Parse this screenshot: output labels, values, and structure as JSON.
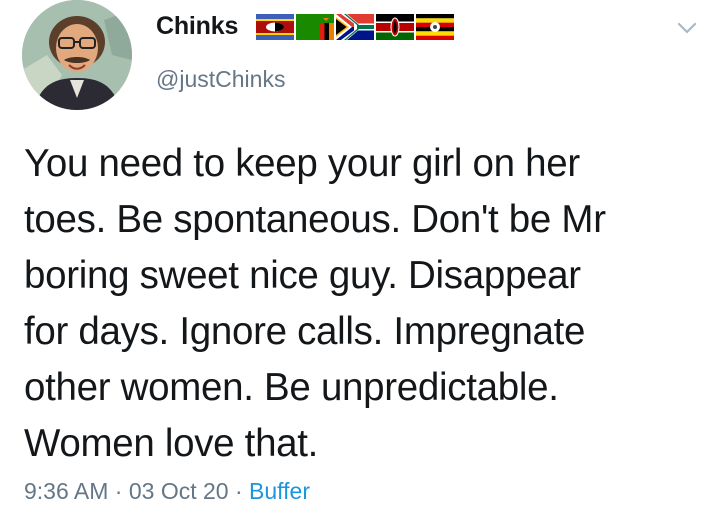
{
  "author": {
    "display_name": "Chinks",
    "handle": "@justChinks",
    "avatar_icon": "avatar-caricature",
    "flags": [
      "eswatini-flag",
      "zambia-flag",
      "south-africa-flag",
      "kenya-flag",
      "uganda-flag"
    ]
  },
  "tweet": {
    "text": "You need to keep your girl on her\ntoes. Be spontaneous. Don't be Mr\nboring sweet nice guy. Disappear\nfor days. Ignore calls. Impregnate\nother women. Be unpredictable.\nWomen love that.",
    "time": "9:36 AM",
    "date": "03 Oct 20",
    "source": "Buffer",
    "separator": "·"
  },
  "colors": {
    "text": "#14171a",
    "secondary": "#657786",
    "link": "#1b95e0"
  },
  "menu_icon": "chevron-down-icon"
}
